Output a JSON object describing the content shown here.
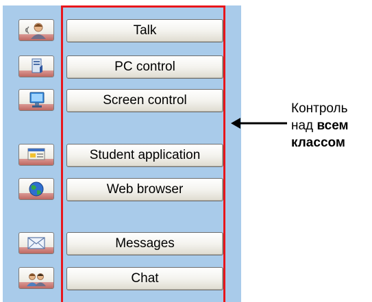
{
  "menu": {
    "items": [
      {
        "icon": "talk-icon",
        "label": "Talk"
      },
      {
        "icon": "pc-control-icon",
        "label": "PC control"
      },
      {
        "icon": "screen-control-icon",
        "label": "Screen control"
      },
      {
        "icon": "student-application-icon",
        "label": "Student application"
      },
      {
        "icon": "web-browser-icon",
        "label": "Web browser"
      },
      {
        "icon": "messages-icon",
        "label": "Messages"
      },
      {
        "icon": "chat-icon",
        "label": "Chat"
      }
    ]
  },
  "annotation": {
    "line1": "Контроль",
    "line2_prefix": "над",
    "line2_bold": "всем",
    "line3_bold": "классом"
  },
  "colors": {
    "panel_background": "#a9cbea",
    "highlight_frame": "#e8161b",
    "arrow": "#000000"
  }
}
